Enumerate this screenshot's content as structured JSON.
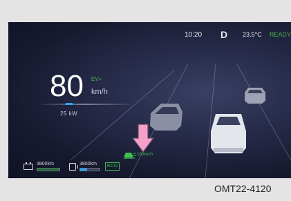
{
  "status": {
    "time": "10:20",
    "gear": "D",
    "temperature": "23.5°C",
    "ready": "READY"
  },
  "speed": {
    "value": "80",
    "mode": "EV+",
    "unit": "km/h"
  },
  "power": {
    "text": "25 kW",
    "level_fraction": 0.3
  },
  "cruise": {
    "set_speed": "100km/h",
    "icon": "adaptive-cruise-car-icon"
  },
  "ranges": {
    "battery_range": "3800km",
    "battery_icon": "battery-icon",
    "battery_level_fraction": 1.0,
    "fuel_range": "3800km",
    "fuel_icon": "fuel-pump-icon",
    "fuel_level_fraction": 0.35,
    "eco_badge": "ECO"
  },
  "annotation": {
    "arrow_icon": "pointer-arrow-down-icon"
  },
  "caption": "OMT22-4120",
  "colors": {
    "accent_green": "#3fbf4f",
    "accent_blue": "#2aa8ff",
    "arrow_pink": "#f4a0c8",
    "screen_background": "#1a1d35"
  }
}
